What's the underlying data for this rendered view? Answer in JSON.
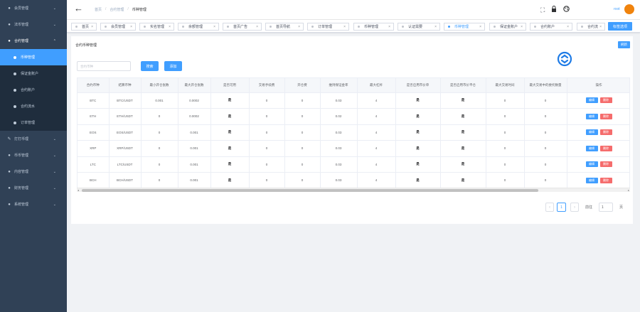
{
  "sidebar": {
    "items": [
      {
        "label": "会员管理",
        "icon": "user-icon",
        "arrow": "⌄"
      },
      {
        "label": "法币管理",
        "icon": "money-icon",
        "arrow": "⌄"
      },
      {
        "label": "合约管理",
        "icon": "contract-icon",
        "arrow": "⌃",
        "open": true,
        "children": [
          {
            "label": "币种管理",
            "active": true
          },
          {
            "label": "保证金账户"
          },
          {
            "label": "合约账户"
          },
          {
            "label": "合约流水"
          },
          {
            "label": "订单管理"
          }
        ]
      },
      {
        "label": "打打币理",
        "icon": "tool-icon",
        "arrow": "⌄"
      },
      {
        "label": "币币管理",
        "icon": "coin-icon",
        "arrow": "⌄"
      },
      {
        "label": "内容管理",
        "icon": "content-icon",
        "arrow": "⌄"
      },
      {
        "label": "财务管理",
        "icon": "finance-icon",
        "arrow": "⌄"
      },
      {
        "label": "系统管理",
        "icon": "system-icon",
        "arrow": "⌄"
      }
    ]
  },
  "header": {
    "back": "←",
    "breadcrumb": [
      "首页",
      "合约管理",
      "币种管理"
    ],
    "separator": "/",
    "icons": [
      "fullscreen-icon",
      "lock-icon",
      "palette-icon"
    ],
    "user": "root"
  },
  "tags": {
    "items": [
      {
        "label": "首页"
      },
      {
        "label": "会员管理"
      },
      {
        "label": "实名管理"
      },
      {
        "label": "余额管理"
      },
      {
        "label": "首页广告"
      },
      {
        "label": "首页导航"
      },
      {
        "label": "订单管理"
      },
      {
        "label": "币种管理"
      },
      {
        "label": "认证需要"
      },
      {
        "label": "币种管理",
        "active": true
      },
      {
        "label": "保证金账户"
      },
      {
        "label": "合约账户"
      },
      {
        "label": "合约流"
      }
    ],
    "close_label": "标签选项"
  },
  "card": {
    "title": "合约币种管理",
    "top_button": "刷新",
    "search_placeholder": "合约币种",
    "search_button": "搜索",
    "add_button": "添加"
  },
  "table": {
    "headers": [
      "合约币种",
      "结算币种",
      "最小开仓张数",
      "最大开仓张数",
      "是否可用",
      "交易手续费",
      "开仓费",
      "维持保证金率",
      "最大杠杆",
      "是否启用市价单",
      "是否启用市价平仓",
      "最大交易时间",
      "最大交易中的委托数量",
      "操作"
    ],
    "rows": [
      [
        "BTC",
        "BTC/USDT",
        "0.001",
        "0.0002",
        "是",
        "0",
        "0",
        "0.03",
        "4",
        "是",
        "是",
        "0",
        "0"
      ],
      [
        "ETH",
        "ETH/USDT",
        "0",
        "0.0002",
        "是",
        "0",
        "0",
        "0.02",
        "4",
        "是",
        "是",
        "0",
        "0"
      ],
      [
        "EOS",
        "EOS/USDT",
        "0",
        "0.001",
        "是",
        "0",
        "0",
        "0.03",
        "4",
        "是",
        "是",
        "0",
        "0"
      ],
      [
        "XRP",
        "XRP/USDT",
        "0",
        "0.001",
        "是",
        "0",
        "0",
        "0.03",
        "4",
        "是",
        "是",
        "0",
        "0"
      ],
      [
        "LTC",
        "LTC/USDT",
        "0",
        "0.001",
        "是",
        "0",
        "0",
        "0.03",
        "4",
        "是",
        "是",
        "0",
        "0"
      ],
      [
        "BCH",
        "BCH/USDT",
        "0",
        "0.001",
        "是",
        "0",
        "0",
        "0.03",
        "4",
        "是",
        "是",
        "0",
        "0"
      ]
    ],
    "edit_label": "编辑",
    "delete_label": "删除"
  },
  "pagination": {
    "prev": "‹",
    "next": "›",
    "current": "1",
    "goto_label": "前往",
    "goto_value": "1",
    "page_suffix": "页"
  },
  "colors": {
    "sidebar": "#304156",
    "primary": "#409eff",
    "danger": "#f56c6c",
    "avatar": "#f0830d"
  }
}
